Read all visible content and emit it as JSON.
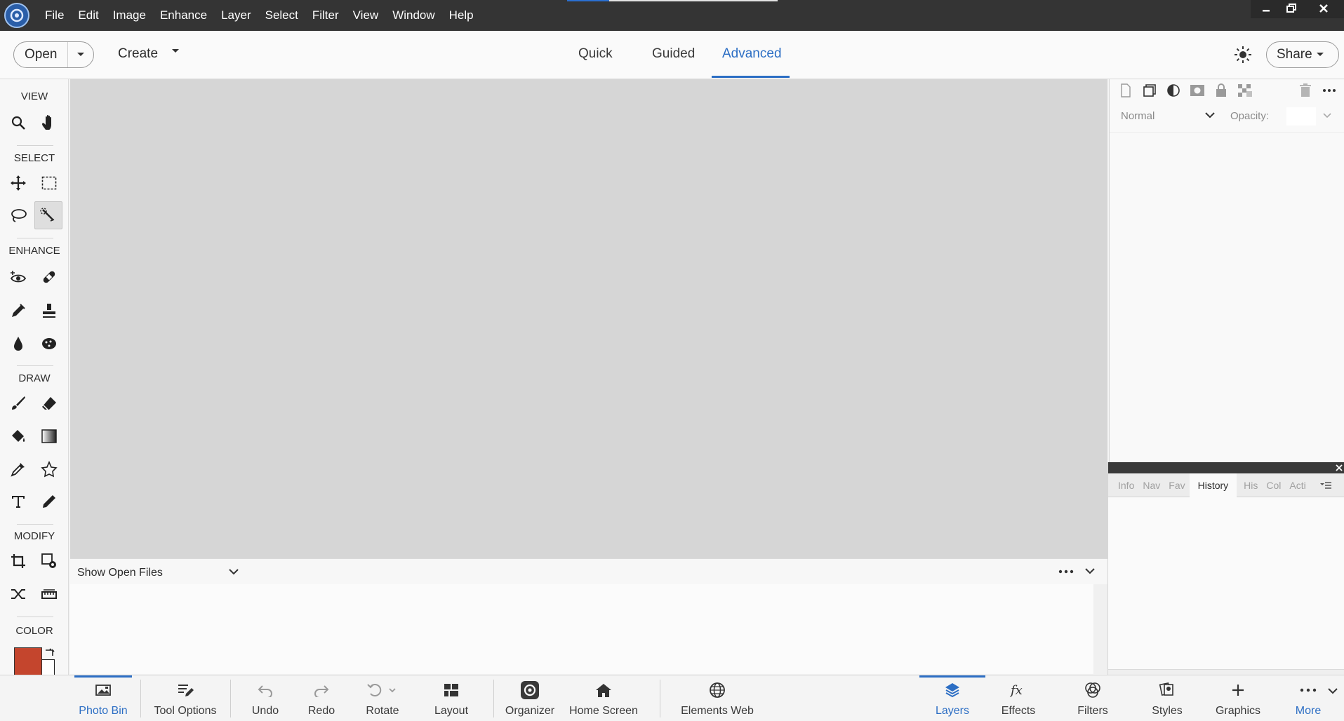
{
  "menu": [
    "File",
    "Edit",
    "Image",
    "Enhance",
    "Layer",
    "Select",
    "Filter",
    "View",
    "Window",
    "Help"
  ],
  "toolbar": {
    "open_label": "Open",
    "create_label": "Create",
    "modes": [
      "Quick",
      "Guided",
      "Advanced"
    ],
    "active_mode": "Advanced",
    "share_label": "Share"
  },
  "toolpanel": {
    "sections": {
      "view": "VIEW",
      "select": "SELECT",
      "enhance": "ENHANCE",
      "draw": "DRAW",
      "modify": "MODIFY",
      "color": "COLOR"
    },
    "foreground_color": "#c4452d",
    "background_color": "#ffffff",
    "active_tool": "quick-selection-tool"
  },
  "photobin": {
    "show_label": "Show Open Files"
  },
  "layers_panel": {
    "blend_mode": "Normal",
    "opacity_label": "Opacity:"
  },
  "history_panel": {
    "tabs": [
      "Info",
      "Nav",
      "Fav",
      "History",
      "His",
      "Col",
      "Acti"
    ],
    "active_tab": "History"
  },
  "bottom_left": [
    {
      "label": "Photo Bin",
      "icon": "photo-bin-icon"
    },
    {
      "label": "Tool Options",
      "icon": "tool-options-icon"
    },
    {
      "label": "Undo",
      "icon": "undo-icon"
    },
    {
      "label": "Redo",
      "icon": "redo-icon"
    },
    {
      "label": "Rotate",
      "icon": "rotate-icon"
    },
    {
      "label": "Layout",
      "icon": "layout-icon"
    },
    {
      "label": "Organizer",
      "icon": "organizer-icon"
    },
    {
      "label": "Home Screen",
      "icon": "home-icon"
    },
    {
      "label": "Elements Web",
      "icon": "globe-icon"
    }
  ],
  "bottom_right": [
    {
      "label": "Layers",
      "icon": "layers-icon"
    },
    {
      "label": "Effects",
      "icon": "fx-icon"
    },
    {
      "label": "Filters",
      "icon": "filters-icon"
    },
    {
      "label": "Styles",
      "icon": "styles-icon"
    },
    {
      "label": "Graphics",
      "icon": "graphics-icon"
    },
    {
      "label": "More",
      "icon": "more-icon"
    }
  ],
  "colors": {
    "accent": "#2c6ec4",
    "titlebar": "#343434",
    "canvas": "#d6d6d6"
  }
}
